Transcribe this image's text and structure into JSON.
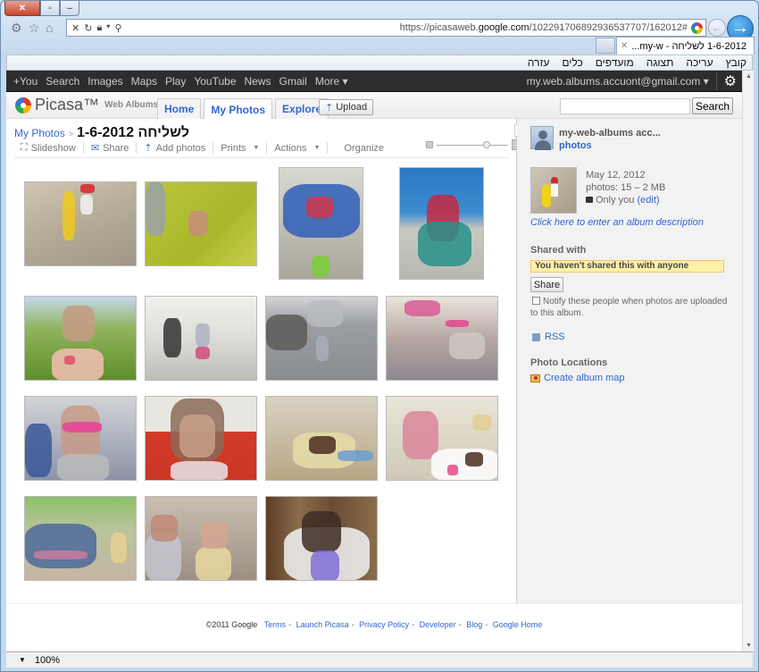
{
  "browser": {
    "url_host_pre": "https://picasaweb.",
    "url_host_bold": "google.com",
    "url_path": "/102291706892936537707/162012#",
    "tab_title": "1-6-2012 לשליחה - my-w...",
    "menu": [
      "קובץ",
      "עריכה",
      "תצוגה",
      "מועדפים",
      "כלים",
      "עזרה"
    ],
    "zoom_level": "100%"
  },
  "gbar": {
    "links": [
      "+You",
      "Search",
      "Images",
      "Maps",
      "Play",
      "YouTube",
      "News",
      "Gmail",
      "More ▾"
    ],
    "account": "my.web.albums.accuont@gmail.com ▾"
  },
  "header": {
    "logo_name": "Picasa™",
    "logo_sub": "Web Albums",
    "tabs": [
      "Home",
      "My Photos",
      "Explore"
    ],
    "active_tab": "My Photos",
    "upload_label": "Upload",
    "search_value": "",
    "search_button": "Search"
  },
  "album": {
    "breadcrumb_root": "My Photos",
    "breadcrumb_sep": ">",
    "title": "1-6-2012 לשליחה",
    "actions": [
      "Slideshow",
      "Share",
      "Add photos",
      "Prints",
      "Actions",
      "Organize"
    ],
    "thumbnail_size_fraction": 0.7,
    "photos": [
      {
        "id": 1,
        "desc": "girl with yellow float ring"
      },
      {
        "id": 2,
        "desc": "girl in green pool"
      },
      {
        "id": 3,
        "desc": "girl in blue chair"
      },
      {
        "id": 4,
        "desc": "girl on green chair"
      },
      {
        "id": 5,
        "desc": "girl in floral dress"
      },
      {
        "id": 6,
        "desc": "girl walking by bin"
      },
      {
        "id": 7,
        "desc": "girl in parking lot"
      },
      {
        "id": 8,
        "desc": "girl in store with pink glasses"
      },
      {
        "id": 9,
        "desc": "girl wearing pink glasses"
      },
      {
        "id": 10,
        "desc": "girl close-up red background"
      },
      {
        "id": 11,
        "desc": "kids table with cake"
      },
      {
        "id": 12,
        "desc": "girl with cake plate"
      },
      {
        "id": 13,
        "desc": "hammock and girl"
      },
      {
        "id": 14,
        "desc": "kids group"
      },
      {
        "id": 15,
        "desc": "girl in white chair"
      }
    ]
  },
  "sidebar": {
    "owner_name": "my-web-albums acc...",
    "owner_link": "photos",
    "date": "May 12, 2012",
    "stats": "photos: 15 – 2 MB",
    "visibility": "Only you",
    "edit_label": "(edit)",
    "description_prompt": "Click here to enter an album description",
    "shared_heading": "Shared with",
    "shared_notice": "You haven't shared this with anyone",
    "share_button": "Share",
    "notify_label": "Notify these people when photos are uploaded to this album.",
    "notify_checked": false,
    "rss_label": "RSS",
    "locations_heading": "Photo Locations",
    "map_label": "Create album map"
  },
  "footer": {
    "copyright": "©2011 Google",
    "links": [
      "Terms",
      "Launch Picasa",
      "Privacy Policy",
      "Developer",
      "Blog",
      "Google Home"
    ]
  }
}
